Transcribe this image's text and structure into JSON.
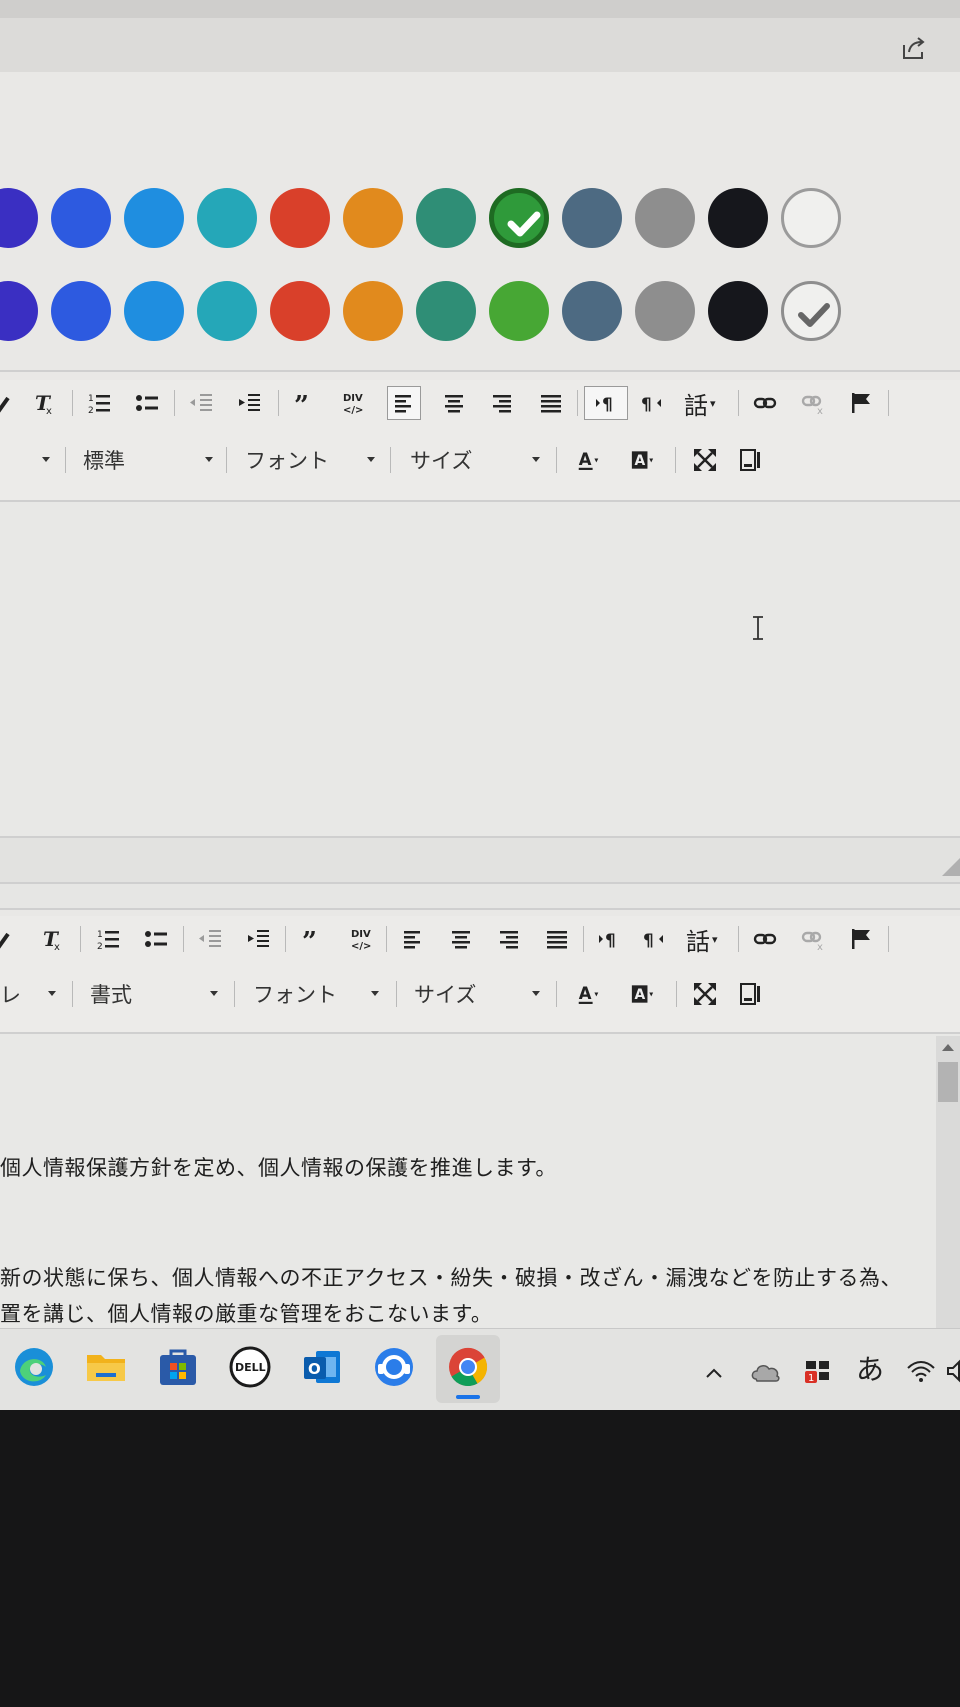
{
  "colors": {
    "row1": [
      "#3a2fc2",
      "#2d5ae0",
      "#1f8ee0",
      "#25a7b8",
      "#d9402a",
      "#e18a1d",
      "#2f8e76",
      "#2f9a3a",
      "#4d6a82",
      "#8e8e8e",
      "#16171c",
      "none"
    ],
    "row2": [
      "#3a2fc2",
      "#2d5ae0",
      "#1f8ee0",
      "#25a7b8",
      "#d9402a",
      "#e18a1d",
      "#2f8e76",
      "#47a734",
      "#4d6a82",
      "#8e8e8e",
      "#16171c",
      "none"
    ]
  },
  "editor1": {
    "toolbar": {
      "talk_button": "話",
      "format_combo": "標準",
      "font_combo": "フォント",
      "size_combo": "サイズ"
    }
  },
  "editor2": {
    "toolbar": {
      "talk_button": "話",
      "style_combo_partial": "レ",
      "format_combo": "書式",
      "font_combo": "フォント",
      "size_combo": "サイズ"
    },
    "content": {
      "line1": "個人情報保護方針を定め、個人情報の保護を推進します。",
      "line2": "新の状態に保ち、個人情報への不正アクセス・紛失・破損・改ざん・漏洩などを防止する為、",
      "line3": "置を講じ、個人情報の厳重な管理をおこないます。"
    }
  },
  "taskbar": {
    "ime_indicator": "あ",
    "apps": [
      "edge-icon",
      "file-explorer-icon",
      "store-icon",
      "dell-icon",
      "outlook-icon",
      "support-icon",
      "chrome-icon"
    ]
  }
}
